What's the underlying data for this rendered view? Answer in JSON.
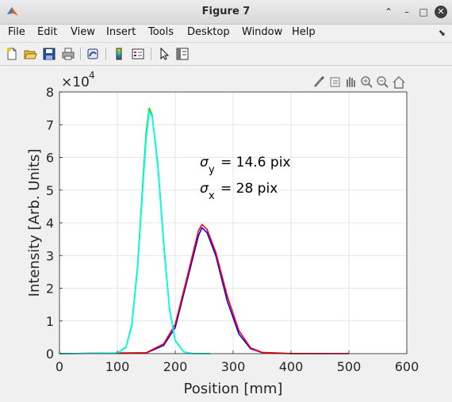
{
  "window": {
    "title": "Figure 7"
  },
  "menu": [
    "File",
    "Edit",
    "View",
    "Insert",
    "Tools",
    "Desktop",
    "Window",
    "Help"
  ],
  "toolbar_icons": [
    "new-figure-icon",
    "open-file-icon",
    "save-icon",
    "print-icon",
    "link-plot-icon",
    "colorbar-icon",
    "legend-icon",
    "edit-plot-icon",
    "property-editor-icon"
  ],
  "axes_toolbar_icons": [
    "brush-icon",
    "data-tips-icon",
    "pan-icon",
    "zoom-in-icon",
    "zoom-out-icon",
    "home-icon"
  ],
  "colors": {
    "blue": "#0000ff",
    "red": "#ff0000",
    "green": "#00e000",
    "cyan": "#00ffff"
  },
  "chart_data": {
    "type": "line",
    "xlabel": "Position [mm]",
    "ylabel": "Intensity [Arb. Units]",
    "xlim": [
      0,
      600
    ],
    "ylim": [
      0,
      80000
    ],
    "xticks": [
      0,
      100,
      200,
      300,
      400,
      500,
      600
    ],
    "yticks": [
      0,
      1,
      2,
      3,
      4,
      5,
      6,
      7,
      8
    ],
    "y_exponent": "×10^4",
    "grid": true,
    "annotations": [
      "σy = 14.6 pix",
      "σx = 28 pix"
    ],
    "series": [
      {
        "color": "blue",
        "x": [
          0,
          150,
          180,
          200,
          220,
          240,
          246,
          255,
          270,
          290,
          310,
          330,
          350,
          400,
          500
        ],
        "y": [
          0,
          200,
          2500,
          8000,
          22000,
          36000,
          38500,
          37000,
          30000,
          16000,
          6000,
          1500,
          300,
          0,
          0
        ]
      },
      {
        "color": "red",
        "x": [
          0,
          150,
          180,
          200,
          220,
          240,
          246,
          255,
          270,
          290,
          310,
          330,
          350,
          400,
          500
        ],
        "y": [
          0,
          300,
          3000,
          9000,
          23000,
          37500,
          39500,
          38000,
          31000,
          17500,
          7000,
          1800,
          400,
          50,
          0
        ]
      },
      {
        "color": "green",
        "x": [
          0,
          100,
          115,
          125,
          135,
          145,
          150,
          155,
          160,
          170,
          180,
          190,
          200,
          215,
          230,
          260
        ],
        "y": [
          0,
          200,
          2000,
          9000,
          27000,
          55000,
          68000,
          75000,
          73000,
          58000,
          34000,
          14000,
          4000,
          500,
          50,
          0
        ]
      },
      {
        "color": "cyan",
        "x": [
          0,
          100,
          115,
          125,
          135,
          145,
          150,
          155,
          160,
          170,
          180,
          190,
          200,
          215,
          230,
          260
        ],
        "y": [
          0,
          180,
          1800,
          8500,
          26000,
          53000,
          66000,
          74000,
          72500,
          57000,
          33000,
          13500,
          3800,
          450,
          40,
          0
        ]
      }
    ]
  }
}
